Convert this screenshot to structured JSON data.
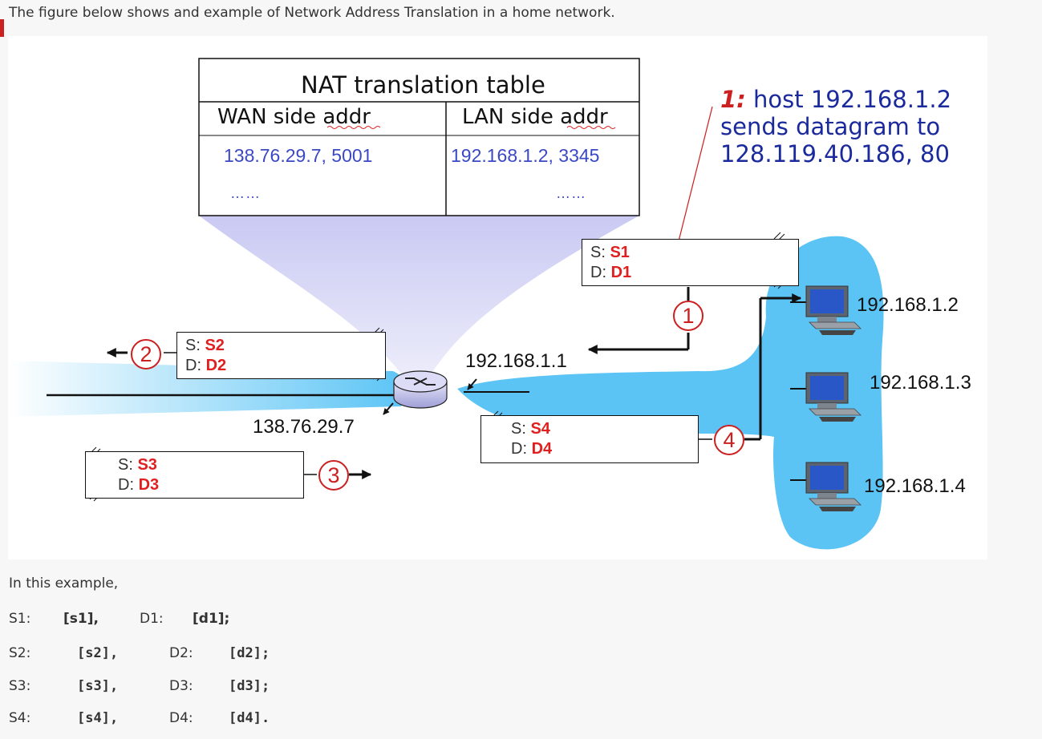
{
  "intro_text": "The figure below shows and example of Network Address Translation in a home network.",
  "nat_table": {
    "title": "NAT translation table",
    "wan_header": "WAN side addr",
    "lan_header": "LAN side addr",
    "wan_value": "138.76.29.7, 5001",
    "lan_value": "192.168.1.2, 3345",
    "dots_left": "……",
    "dots_right": "……"
  },
  "note": {
    "step": "1:",
    "line1": " host 192.168.1.2",
    "line2": "sends datagram to",
    "line3": "128.119.40.186, 80"
  },
  "packets": {
    "p1": {
      "s_label": "S: ",
      "s_value": "S1",
      "d_label": "D: ",
      "d_value": "D1"
    },
    "p2": {
      "s_label": "S: ",
      "s_value": "S2",
      "d_label": "D: ",
      "d_value": "D2"
    },
    "p3": {
      "s_label": "S: ",
      "s_value": "S3",
      "d_label": "D: ",
      "d_value": "D3"
    },
    "p4": {
      "s_label": "S: ",
      "s_value": "S4",
      "d_label": "D: ",
      "d_value": "D4"
    }
  },
  "steps": {
    "one": "1",
    "two": "2",
    "three": "3",
    "four": "4"
  },
  "addresses": {
    "router_lan": "192.168.1.1",
    "router_wan": "138.76.29.7",
    "host1": "192.168.1.2",
    "host2": "192.168.1.3",
    "host3": "192.168.1.4"
  },
  "question": {
    "lead": "In this example,",
    "rows": [
      {
        "s_label": "S1:",
        "s_blank": "[s1],",
        "d_label": "D1:",
        "d_blank": "[d1];"
      },
      {
        "s_label": "S2:",
        "s_blank": "[s2],",
        "d_label": "D2:",
        "d_blank": "[d2];"
      },
      {
        "s_label": "S3:",
        "s_blank": "[s3],",
        "d_label": "D3:",
        "d_blank": "[d3];"
      },
      {
        "s_label": "S4:",
        "s_blank": "[s4],",
        "d_label": "D4:",
        "d_blank": "[d4]."
      }
    ]
  },
  "colors": {
    "accent_red": "#cc1f1f",
    "value_red": "#e02020",
    "blue_text": "#1a2a9c",
    "lan_cloud": "#5bc4f5",
    "nat_beam": "#c9c9f3"
  },
  "icons": [
    "router-icon",
    "desktop-computer-icon"
  ]
}
